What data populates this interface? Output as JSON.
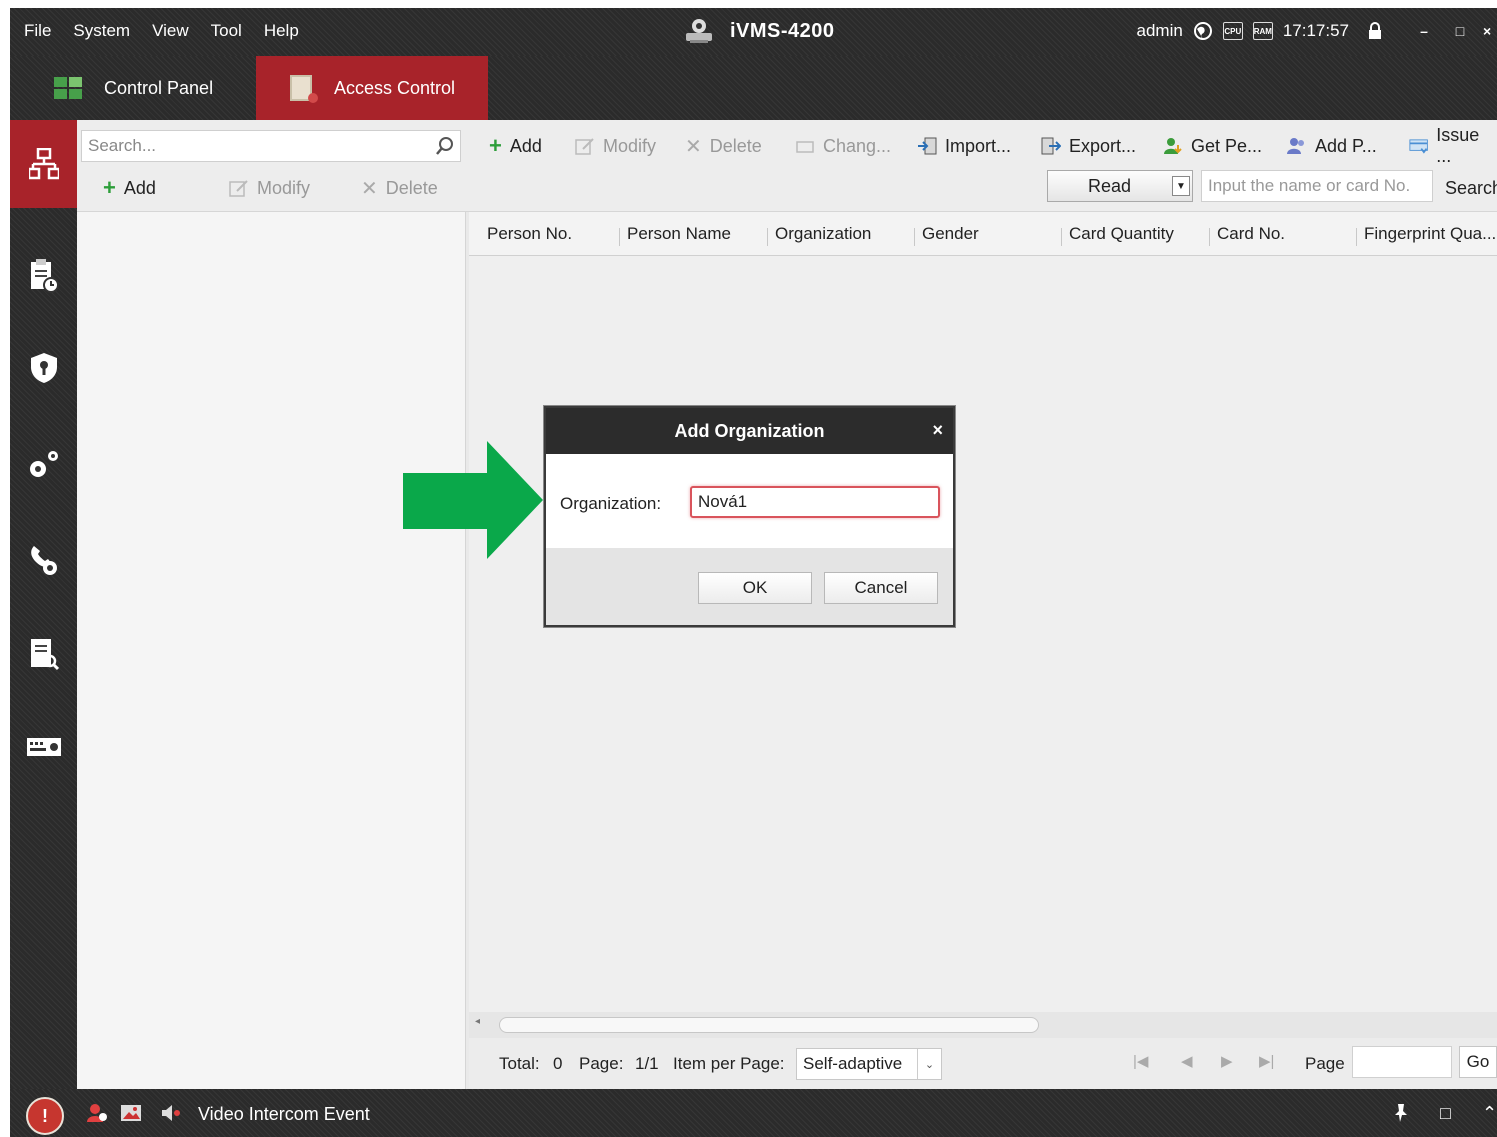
{
  "menu": [
    "File",
    "System",
    "View",
    "Tool",
    "Help"
  ],
  "app_title": "iVMS-4200",
  "status": {
    "user": "admin",
    "cpu": "CPU",
    "ram": "RAM",
    "time": "17:17:57",
    "minimize": "–",
    "maximize": "□",
    "close": "×"
  },
  "tabs": [
    {
      "label": "Control Panel",
      "icon": "grid-icon"
    },
    {
      "label": "Access Control",
      "icon": "door-icon"
    }
  ],
  "left_search": {
    "placeholder": "Search..."
  },
  "org_toolbar": {
    "add": "Add",
    "modify": "Modify",
    "delete": "Delete"
  },
  "person_toolbar": {
    "add": "Add",
    "modify": "Modify",
    "delete": "Delete",
    "change": "Chang...",
    "import": "Import...",
    "export": "Export...",
    "get_person": "Get Pe...",
    "add_person": "Add P...",
    "issue": "Issue ..."
  },
  "card_reader": {
    "read": "Read",
    "placeholder": "Input the name or card No.",
    "search": "Search"
  },
  "table": {
    "columns": [
      "Person No.",
      "Person Name",
      "Organization",
      "Gender",
      "Card Quantity",
      "Card No.",
      "Fingerprint Qua..."
    ],
    "rows": []
  },
  "pagination": {
    "total_label": "Total:",
    "total": "0",
    "page_label": "Page:",
    "page": "1/1",
    "per_page_label": "Item per Page:",
    "per_page": "Self-adaptive",
    "page_text": "Page",
    "go": "Go"
  },
  "statusbar": {
    "event": "Video Intercom Event",
    "pin": "📌",
    "restore": "□",
    "collapse": "⌃"
  },
  "dialog": {
    "title": "Add Organization",
    "close": "×",
    "label": "Organization:",
    "value": "Nová1",
    "ok": "OK",
    "cancel": "Cancel"
  },
  "colors": {
    "accent": "#a8232a",
    "arrow": "#0aa84a",
    "add_green": "#2d9e3a"
  }
}
